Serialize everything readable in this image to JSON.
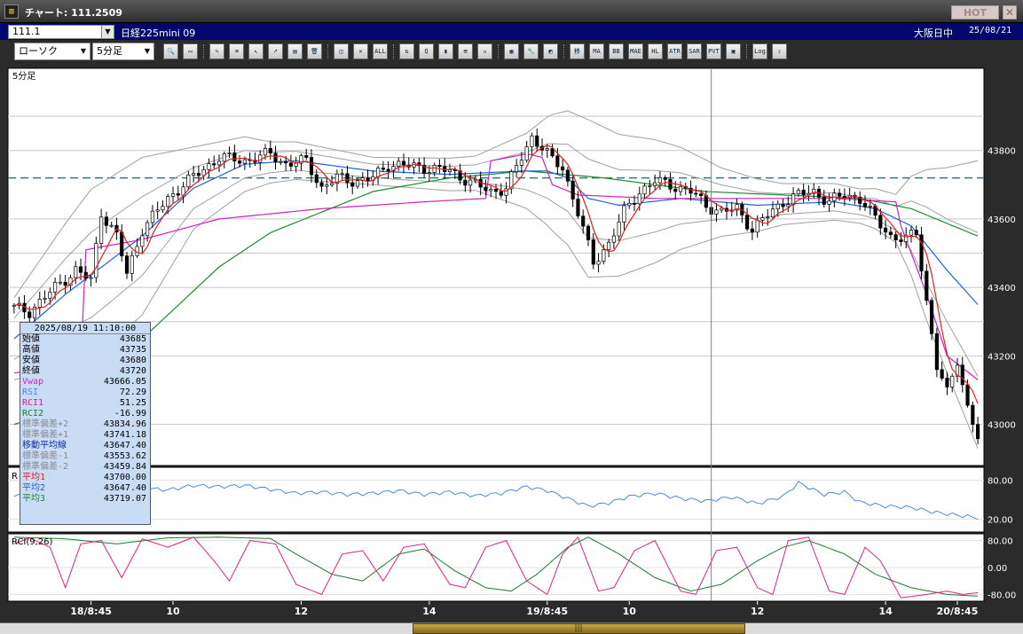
{
  "window": {
    "title": "チャート: 111.2509",
    "hot_label": "HOT",
    "close_label": "✕",
    "app_icon": "chart-app-icon"
  },
  "infobar": {
    "symbol_code": "111.1",
    "instrument_name": "日経225mini 09",
    "exchange": "大阪日中",
    "date": "25/08/21"
  },
  "toolbar": {
    "chart_type": "ローソク",
    "interval": "5分足",
    "tool_buttons": [
      {
        "name": "zoom-icon",
        "glyph": "🔍"
      },
      {
        "name": "window-icon",
        "glyph": "▭"
      },
      {
        "name": "pen-icon",
        "glyph": "✎"
      },
      {
        "name": "eraser-icon",
        "glyph": "⌫"
      },
      {
        "name": "cursor-icon",
        "glyph": "↖"
      },
      {
        "name": "arrow-icon",
        "glyph": "➚"
      },
      {
        "name": "memo-icon",
        "glyph": "▤"
      },
      {
        "name": "trash-icon",
        "glyph": "🗑"
      },
      {
        "name": "mark-icon",
        "glyph": "◫"
      },
      {
        "name": "mark-delete-icon",
        "glyph": "✕"
      },
      {
        "name": "all-delete-icon",
        "glyph": "ALL"
      },
      {
        "name": "compare-icon",
        "glyph": "⇅"
      },
      {
        "name": "search-chart-icon",
        "glyph": "Q"
      },
      {
        "name": "bar-chart-icon",
        "glyph": "▮"
      },
      {
        "name": "step-icon",
        "glyph": "⊞"
      },
      {
        "name": "disabled-icon",
        "glyph": "▫"
      },
      {
        "name": "settings-grid-icon",
        "glyph": "▦"
      },
      {
        "name": "wrench-icon",
        "glyph": "🔧"
      },
      {
        "name": "color-icon",
        "glyph": "◩"
      },
      {
        "name": "moving-average-button",
        "glyph": "移"
      },
      {
        "name": "ma-button",
        "glyph": "MA"
      },
      {
        "name": "bb-button",
        "glyph": "BB"
      },
      {
        "name": "mae-button",
        "glyph": "MAE"
      },
      {
        "name": "hl-button",
        "glyph": "HL"
      },
      {
        "name": "atr-button",
        "glyph": "ATR"
      },
      {
        "name": "parabolic-button",
        "glyph": "SAR"
      },
      {
        "name": "pvt-button",
        "glyph": "PVT"
      },
      {
        "name": "frame-button",
        "glyph": "▣"
      },
      {
        "name": "log-button",
        "glyph": "Log"
      },
      {
        "name": "export-icon",
        "glyph": "⇪"
      }
    ]
  },
  "main_panel": {
    "label": "5分足",
    "y_ticks": [
      "43800",
      "43600",
      "43400",
      "43200",
      "43000"
    ]
  },
  "rsi_panel": {
    "label": "R",
    "y_ticks": [
      "80.00",
      "20.00"
    ]
  },
  "rci_panel": {
    "label": "RCI(9,26)",
    "y_ticks": [
      "80.00",
      "0.00",
      "-80.00"
    ]
  },
  "x_axis": {
    "labels": [
      "18/8:45",
      "10",
      "12",
      "14",
      "19/8:45",
      "10",
      "12",
      "14",
      "20/8:45"
    ]
  },
  "data_window": {
    "timestamp": "2025/08/19  11:10:00",
    "rows": [
      {
        "label": "始値",
        "value": "43685",
        "color": "#000000"
      },
      {
        "label": "高値",
        "value": "43735",
        "color": "#000000"
      },
      {
        "label": "安値",
        "value": "43680",
        "color": "#000000"
      },
      {
        "label": "終値",
        "value": "43720",
        "color": "#000000"
      },
      {
        "label": "Vwap",
        "value": "43666.05",
        "color": "#d020c0"
      },
      {
        "label": "RSI",
        "value": "72.29",
        "color": "#4a8ae0"
      },
      {
        "label": "RCI1",
        "value": "51.25",
        "color": "#e0208a"
      },
      {
        "label": "RCI2",
        "value": "-16.99",
        "color": "#207a30"
      },
      {
        "label": "標準偏差+2",
        "value": "43834.96",
        "color": "#8a8a8a"
      },
      {
        "label": "標準偏差+1",
        "value": "43741.18",
        "color": "#8a8a8a"
      },
      {
        "label": "移動平均線",
        "value": "43647.40",
        "color": "#1030a0"
      },
      {
        "label": "標準偏差-1",
        "value": "43553.62",
        "color": "#8a8a8a"
      },
      {
        "label": "標準偏差-2",
        "value": "43459.84",
        "color": "#8a8a8a"
      },
      {
        "label": "平均1",
        "value": "43700.00",
        "color": "#e02020"
      },
      {
        "label": "平均2",
        "value": "43647.40",
        "color": "#2060e0"
      },
      {
        "label": "平均3",
        "value": "43719.07",
        "color": "#208a30"
      }
    ]
  },
  "colors": {
    "background": "#ffffff",
    "frame": "#2b2b2b",
    "grid": "#c8c8c8",
    "candle_up": "#ffffff",
    "candle_down": "#000000",
    "ma1": "#e02020",
    "ma2": "#2060e0",
    "ma3": "#208a30",
    "vwap": "#d020c0",
    "bollinger": "#a0a0a0",
    "dashed_level": "#2a7a8a",
    "rsi": "#4a8ae0",
    "rci1": "#e0208a",
    "rci2": "#207a30"
  },
  "chart_data": {
    "type": "candlestick",
    "panels": [
      "price",
      "rsi",
      "rci"
    ],
    "price_ylim": [
      42880,
      44040
    ],
    "rsi_ylim": [
      0,
      100
    ],
    "rci_ylim": [
      -100,
      100
    ],
    "dashed_level": 43720,
    "anchors": {
      "close": [
        [
          0,
          43340
        ],
        [
          3,
          43330
        ],
        [
          8,
          43400
        ],
        [
          12,
          43450
        ],
        [
          15,
          43420
        ],
        [
          17,
          43620
        ],
        [
          20,
          43550
        ],
        [
          22,
          43440
        ],
        [
          25,
          43570
        ],
        [
          30,
          43660
        ],
        [
          33,
          43700
        ],
        [
          40,
          43780
        ],
        [
          45,
          43770
        ],
        [
          50,
          43790
        ],
        [
          53,
          43760
        ],
        [
          57,
          43770
        ],
        [
          60,
          43690
        ],
        [
          63,
          43720
        ],
        [
          67,
          43710
        ],
        [
          70,
          43720
        ],
        [
          73,
          43760
        ],
        [
          80,
          43750
        ],
        [
          85,
          43740
        ],
        [
          90,
          43700
        ],
        [
          93,
          43680
        ],
        [
          96,
          43690
        ],
        [
          99,
          43780
        ],
        [
          101,
          43840
        ],
        [
          103,
          43810
        ],
        [
          105,
          43770
        ],
        [
          107,
          43750
        ],
        [
          110,
          43620
        ],
        [
          113,
          43470
        ],
        [
          116,
          43530
        ],
        [
          119,
          43620
        ],
        [
          122,
          43680
        ],
        [
          125,
          43710
        ],
        [
          128,
          43700
        ],
        [
          132,
          43680
        ],
        [
          135,
          43640
        ],
        [
          138,
          43620
        ],
        [
          141,
          43630
        ],
        [
          144,
          43570
        ],
        [
          147,
          43610
        ],
        [
          150,
          43650
        ],
        [
          153,
          43670
        ],
        [
          156,
          43680
        ],
        [
          159,
          43650
        ],
        [
          162,
          43670
        ],
        [
          165,
          43660
        ],
        [
          168,
          43600
        ],
        [
          171,
          43550
        ],
        [
          174,
          43540
        ],
        [
          176,
          43560
        ],
        [
          178,
          43360
        ],
        [
          180,
          43170
        ],
        [
          182,
          43090
        ],
        [
          184,
          43190
        ],
        [
          186,
          43050
        ],
        [
          188,
          42960
        ]
      ],
      "ma2": [
        [
          0,
          43250
        ],
        [
          10,
          43380
        ],
        [
          18,
          43470
        ],
        [
          25,
          43550
        ],
        [
          35,
          43690
        ],
        [
          45,
          43760
        ],
        [
          55,
          43770
        ],
        [
          70,
          43740
        ],
        [
          85,
          43730
        ],
        [
          99,
          43740
        ],
        [
          104,
          43740
        ],
        [
          108,
          43720
        ],
        [
          112,
          43660
        ],
        [
          118,
          43640
        ],
        [
          130,
          43660
        ],
        [
          145,
          43640
        ],
        [
          160,
          43650
        ],
        [
          168,
          43630
        ],
        [
          175,
          43580
        ],
        [
          182,
          43450
        ],
        [
          188,
          43350
        ]
      ],
      "ma3": [
        [
          0,
          43000
        ],
        [
          12,
          43060
        ],
        [
          20,
          43180
        ],
        [
          30,
          43320
        ],
        [
          40,
          43460
        ],
        [
          50,
          43560
        ],
        [
          60,
          43620
        ],
        [
          70,
          43680
        ],
        [
          85,
          43720
        ],
        [
          100,
          43740
        ],
        [
          115,
          43720
        ],
        [
          135,
          43680
        ],
        [
          150,
          43670
        ],
        [
          165,
          43660
        ],
        [
          175,
          43630
        ],
        [
          188,
          43550
        ]
      ],
      "vwap": [
        [
          0,
          43150
        ],
        [
          13,
          43180
        ],
        [
          14,
          43510
        ],
        [
          25,
          43540
        ],
        [
          40,
          43600
        ],
        [
          60,
          43630
        ],
        [
          80,
          43650
        ],
        [
          92,
          43660
        ],
        [
          93,
          43770
        ],
        [
          100,
          43790
        ],
        [
          103,
          43780
        ],
        [
          105,
          43700
        ],
        [
          110,
          43670
        ],
        [
          125,
          43660
        ],
        [
          140,
          43660
        ],
        [
          160,
          43660
        ],
        [
          172,
          43650
        ],
        [
          173,
          43580
        ],
        [
          178,
          43380
        ],
        [
          182,
          43200
        ],
        [
          188,
          43130
        ]
      ],
      "bb_width": [
        [
          0,
          120
        ],
        [
          15,
          250
        ],
        [
          25,
          230
        ],
        [
          35,
          120
        ],
        [
          50,
          60
        ],
        [
          70,
          40
        ],
        [
          90,
          50
        ],
        [
          100,
          110
        ],
        [
          105,
          170
        ],
        [
          112,
          230
        ],
        [
          125,
          180
        ],
        [
          138,
          100
        ],
        [
          150,
          60
        ],
        [
          165,
          50
        ],
        [
          172,
          70
        ],
        [
          178,
          220
        ],
        [
          188,
          420
        ]
      ],
      "rsi": [
        [
          0,
          55
        ],
        [
          5,
          60
        ],
        [
          10,
          62
        ],
        [
          15,
          57
        ],
        [
          20,
          60
        ],
        [
          25,
          68
        ],
        [
          30,
          65
        ],
        [
          35,
          72
        ],
        [
          40,
          70
        ],
        [
          45,
          72
        ],
        [
          50,
          66
        ],
        [
          55,
          60
        ],
        [
          60,
          62
        ],
        [
          65,
          58
        ],
        [
          70,
          60
        ],
        [
          75,
          64
        ],
        [
          80,
          58
        ],
        [
          85,
          62
        ],
        [
          90,
          56
        ],
        [
          95,
          60
        ],
        [
          100,
          70
        ],
        [
          104,
          64
        ],
        [
          108,
          52
        ],
        [
          112,
          40
        ],
        [
          116,
          45
        ],
        [
          120,
          55
        ],
        [
          125,
          60
        ],
        [
          130,
          52
        ],
        [
          135,
          48
        ],
        [
          140,
          54
        ],
        [
          145,
          44
        ],
        [
          150,
          55
        ],
        [
          153,
          76
        ],
        [
          158,
          58
        ],
        [
          162,
          62
        ],
        [
          165,
          46
        ],
        [
          170,
          40
        ],
        [
          175,
          38
        ],
        [
          180,
          30
        ],
        [
          185,
          25
        ],
        [
          188,
          22
        ]
      ],
      "rci1": [
        [
          0,
          70
        ],
        [
          3,
          88
        ],
        [
          7,
          60
        ],
        [
          10,
          -60
        ],
        [
          13,
          70
        ],
        [
          17,
          80
        ],
        [
          21,
          -30
        ],
        [
          25,
          85
        ],
        [
          30,
          60
        ],
        [
          35,
          90
        ],
        [
          39,
          20
        ],
        [
          42,
          -40
        ],
        [
          46,
          80
        ],
        [
          51,
          70
        ],
        [
          55,
          -50
        ],
        [
          60,
          -80
        ],
        [
          64,
          40
        ],
        [
          68,
          50
        ],
        [
          72,
          -40
        ],
        [
          76,
          60
        ],
        [
          80,
          70
        ],
        [
          85,
          -50
        ],
        [
          88,
          -60
        ],
        [
          92,
          60
        ],
        [
          96,
          80
        ],
        [
          100,
          -40
        ],
        [
          104,
          -80
        ],
        [
          107,
          40
        ],
        [
          110,
          90
        ],
        [
          114,
          -70
        ],
        [
          117,
          -60
        ],
        [
          121,
          50
        ],
        [
          125,
          80
        ],
        [
          130,
          -70
        ],
        [
          133,
          -80
        ],
        [
          137,
          50
        ],
        [
          141,
          60
        ],
        [
          145,
          -60
        ],
        [
          148,
          -80
        ],
        [
          151,
          80
        ],
        [
          155,
          90
        ],
        [
          159,
          -70
        ],
        [
          162,
          -80
        ],
        [
          166,
          60
        ],
        [
          169,
          20
        ],
        [
          173,
          -90
        ],
        [
          178,
          -80
        ],
        [
          182,
          -70
        ],
        [
          185,
          -80
        ],
        [
          188,
          -75
        ]
      ],
      "rci2": [
        [
          0,
          90
        ],
        [
          10,
          85
        ],
        [
          20,
          70
        ],
        [
          30,
          88
        ],
        [
          40,
          90
        ],
        [
          50,
          86
        ],
        [
          55,
          40
        ],
        [
          62,
          -20
        ],
        [
          68,
          -40
        ],
        [
          75,
          40
        ],
        [
          80,
          55
        ],
        [
          86,
          -10
        ],
        [
          92,
          -60
        ],
        [
          97,
          -70
        ],
        [
          102,
          -20
        ],
        [
          108,
          60
        ],
        [
          112,
          90
        ],
        [
          118,
          40
        ],
        [
          125,
          -30
        ],
        [
          132,
          -70
        ],
        [
          138,
          -50
        ],
        [
          145,
          20
        ],
        [
          150,
          60
        ],
        [
          155,
          80
        ],
        [
          162,
          40
        ],
        [
          168,
          -20
        ],
        [
          175,
          -60
        ],
        [
          182,
          -80
        ],
        [
          188,
          -85
        ]
      ]
    },
    "n_bars": 189,
    "crosshair_bar": 136
  }
}
